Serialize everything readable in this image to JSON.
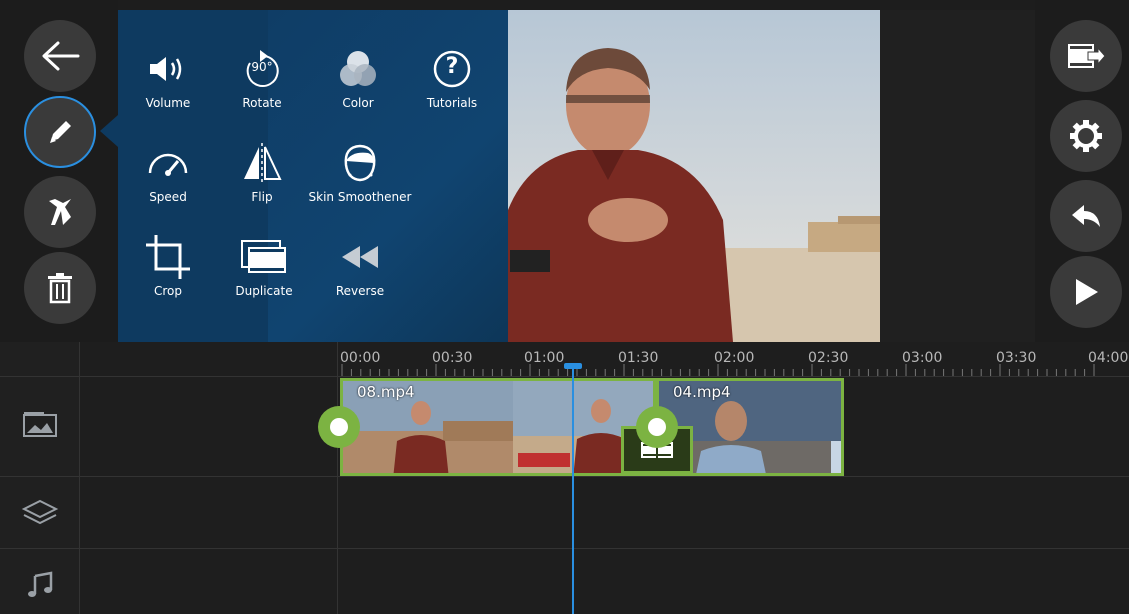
{
  "edit_menu": {
    "tools": [
      {
        "label": "Volume",
        "icon": "speaker-icon"
      },
      {
        "label": "Rotate",
        "icon": "rotate-90-icon"
      },
      {
        "label": "Color",
        "icon": "color-circles-icon"
      },
      {
        "label": "Tutorials",
        "icon": "question-icon"
      },
      {
        "label": "Speed",
        "icon": "speedometer-icon"
      },
      {
        "label": "Flip",
        "icon": "flip-icon"
      },
      {
        "label": "Skin Smoothener",
        "icon": "face-icon"
      },
      {
        "label": "Crop",
        "icon": "crop-icon"
      },
      {
        "label": "Duplicate",
        "icon": "duplicate-icon"
      },
      {
        "label": "Reverse",
        "icon": "rewind-icon"
      }
    ],
    "rotate_badge": "90°",
    "tutorials_glyph": "?"
  },
  "left_toolbar": {
    "buttons": [
      "back-arrow-icon",
      "pencil-icon",
      "split-icon",
      "trash-icon"
    ]
  },
  "right_toolbar": {
    "buttons": [
      "export-icon",
      "gear-icon",
      "undo-icon",
      "play-icon"
    ]
  },
  "timeline": {
    "ruler_labels": [
      "00:00",
      "00:30",
      "01:00",
      "01:30",
      "02:00",
      "02:30",
      "03:00",
      "03:30",
      "04:00"
    ],
    "clips": [
      {
        "name": "08.mp4"
      },
      {
        "name": "04.mp4"
      }
    ],
    "track_icons": [
      "video-track-icon",
      "layers-icon",
      "music-note-icon"
    ]
  },
  "colors": {
    "accent_blue": "#2a8fe0",
    "clip_green": "#7cb342",
    "panel_blue": "#0e3a60"
  }
}
